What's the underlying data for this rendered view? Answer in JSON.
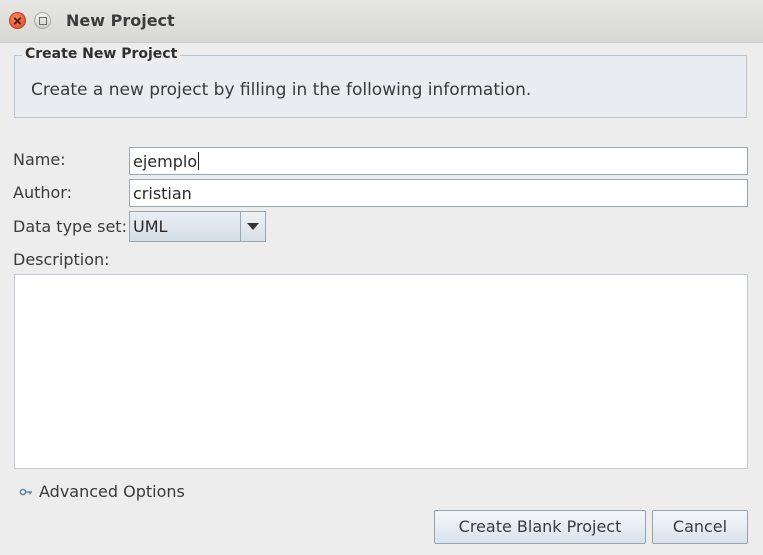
{
  "window": {
    "title": "New Project"
  },
  "header": {
    "group_title": "Create New Project",
    "description": "Create a new project by filling in the following information."
  },
  "form": {
    "name_label": "Name:",
    "name_value": "ejemplo",
    "author_label": "Author:",
    "author_value": "cristian",
    "datatype_label": "Data type set:",
    "datatype_value": "UML",
    "description_label": "Description:",
    "description_value": ""
  },
  "advanced": {
    "label": "Advanced Options"
  },
  "buttons": {
    "create_label": "Create Blank Project",
    "cancel_label": "Cancel"
  },
  "icons": {
    "close": "close-icon",
    "maximize": "maximize-icon",
    "dropdown": "chevron-down-icon",
    "advanced": "key-icon"
  }
}
